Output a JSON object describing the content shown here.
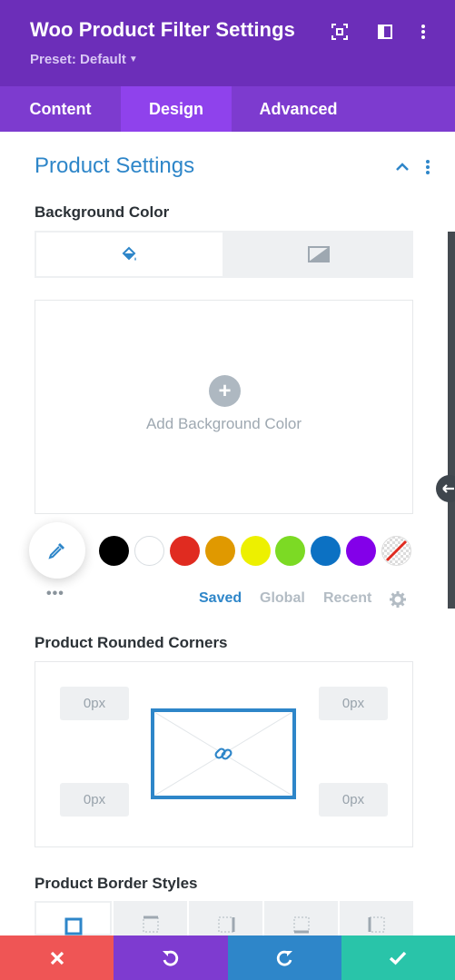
{
  "header": {
    "title": "Woo Product Filter Settings",
    "preset": "Preset: Default",
    "icons": [
      "fullscreen-icon",
      "sidebar-layout-icon",
      "more-vertical-icon"
    ]
  },
  "tabs": [
    {
      "label": "Content",
      "active": false
    },
    {
      "label": "Design",
      "active": true
    },
    {
      "label": "Advanced",
      "active": false
    }
  ],
  "section": {
    "title": "Product Settings"
  },
  "background": {
    "label": "Background Color",
    "add_text": "Add Background Color"
  },
  "palette": {
    "colors": [
      "#000000",
      "#ffffff",
      "#e02b20",
      "#e09900",
      "#edf000",
      "#7cda24",
      "#0c71c3",
      "#8300e9"
    ],
    "tabs": [
      "Saved",
      "Global",
      "Recent"
    ],
    "active_tab": "Saved"
  },
  "corners": {
    "label": "Product Rounded Corners",
    "top_left": "0px",
    "top_right": "0px",
    "bottom_left": "0px",
    "bottom_right": "0px"
  },
  "border": {
    "label": "Product Border Styles"
  },
  "colors": {
    "header": "#6c2eb9",
    "tabs": "#7d3bcf",
    "active_tab": "#8f42ec",
    "accent": "#2e86c9",
    "cancel": "#ef5555",
    "undo": "#7e3bd0",
    "redo": "#2e86c9",
    "save": "#29c4a9"
  }
}
